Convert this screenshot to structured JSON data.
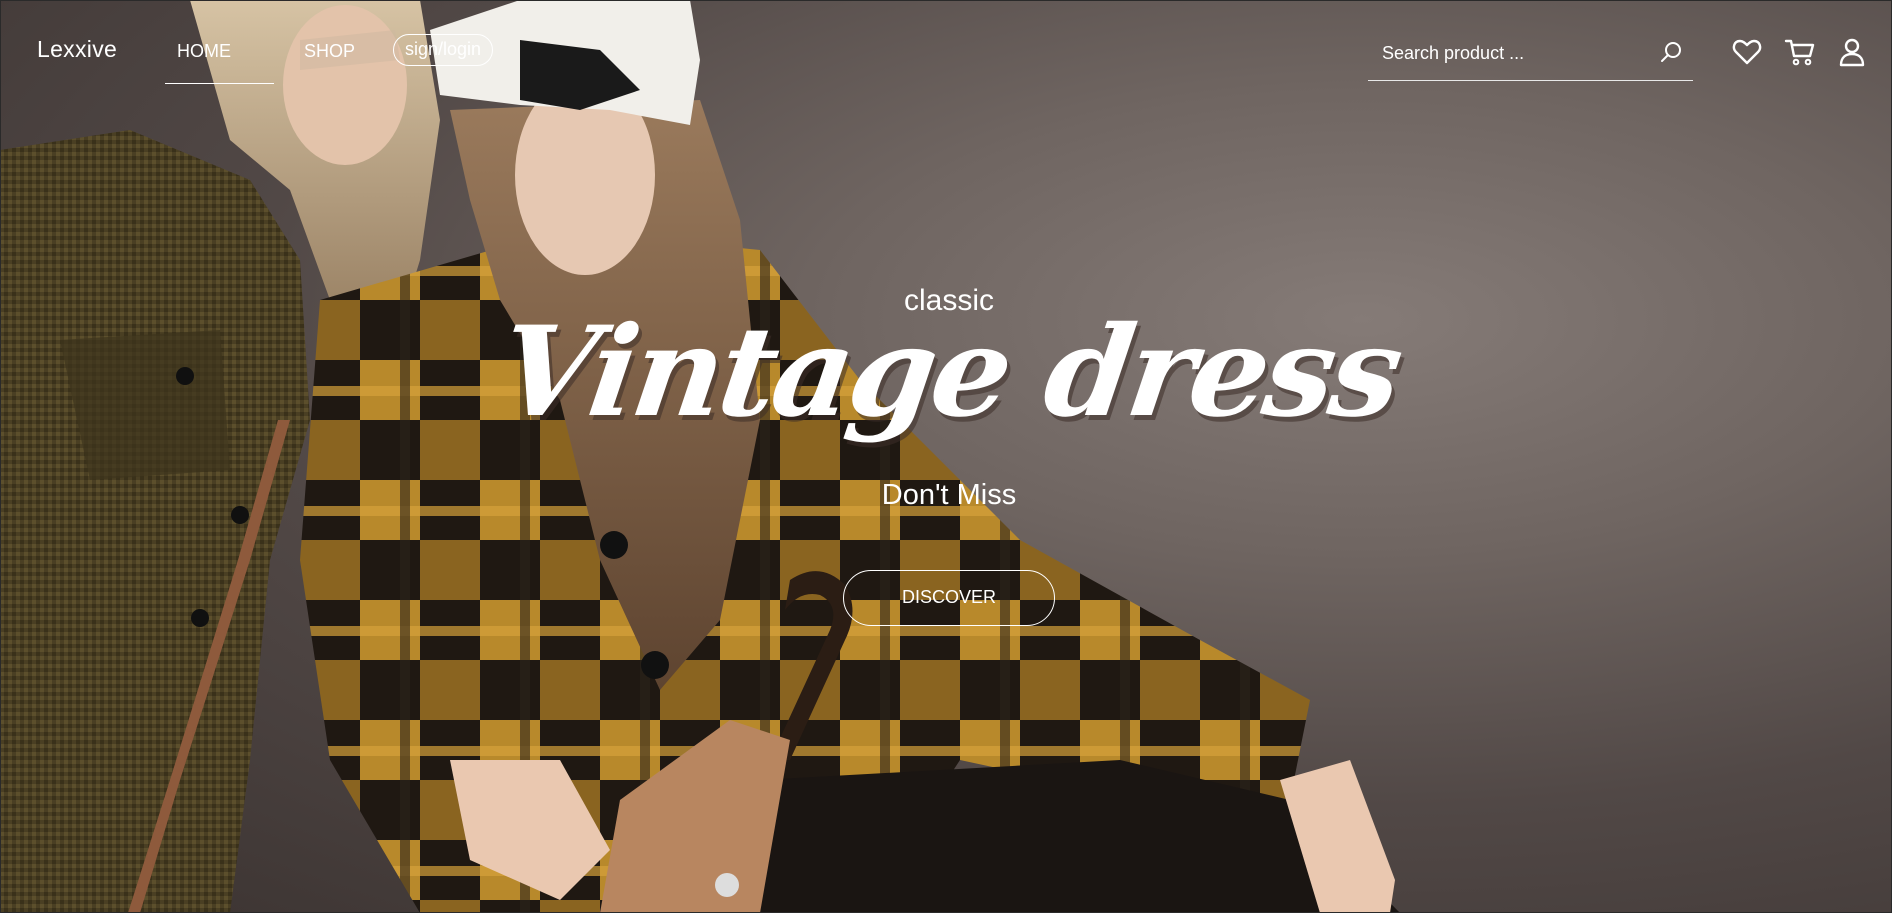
{
  "brand": {
    "name": "Lexxive"
  },
  "nav": {
    "links": [
      {
        "label": "HOME",
        "active": true
      },
      {
        "label": "SHOP",
        "active": false
      }
    ],
    "sign_label": "sign/login"
  },
  "search": {
    "placeholder": "Search product ...",
    "value": "",
    "icon": "search-icon"
  },
  "header_icons": [
    {
      "name": "heart-icon",
      "label": "wishlist"
    },
    {
      "name": "cart-icon",
      "label": "cart"
    },
    {
      "name": "user-icon",
      "label": "account"
    }
  ],
  "hero": {
    "subtitle": "classic",
    "title": "Vintage dress",
    "tagline": "Don't Miss",
    "cta_label": "DISCOVER",
    "image_description": "two models in plaid and tweed coats"
  },
  "colors": {
    "text": "#ffffff",
    "background": "#5a504d",
    "coat_dark": "#2a2218",
    "coat_ochre": "#b8892b",
    "tweed": "#4f4326"
  }
}
